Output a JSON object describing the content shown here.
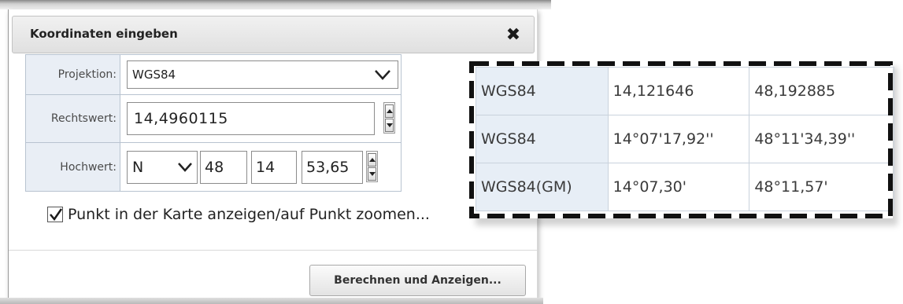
{
  "dialog": {
    "title": "Koordinaten eingeben",
    "close_icon": "close-icon",
    "form": {
      "projection_label": "Projektion:",
      "projection_value": "WGS84",
      "rechtswert_label": "Rechtswert:",
      "rechtswert_value": "14,4960115",
      "hochwert_label": "Hochwert:",
      "hochwert_hemisphere": "N",
      "hochwert_degrees": "48",
      "hochwert_minutes": "14",
      "hochwert_seconds": "53,65"
    },
    "checkbox_checked": true,
    "checkbox_label": "Punkt in der Karte anzeigen/auf Punkt zoomen...",
    "calc_button_label": "Berechnen und Anzeigen..."
  },
  "coordinate_table": {
    "rows": [
      {
        "projection": "WGS84",
        "lon": "14,121646",
        "lat": "48,192885"
      },
      {
        "projection": "WGS84",
        "lon": "14°07'17,92''",
        "lat": "48°11'34,39''"
      },
      {
        "projection": "WGS84(GM)",
        "lon": "14°07,30'",
        "lat": "48°11,57'"
      }
    ]
  },
  "colors": {
    "label_bg": "#e9eef5",
    "border": "#b8c3d0",
    "dash_border": "#111111"
  }
}
